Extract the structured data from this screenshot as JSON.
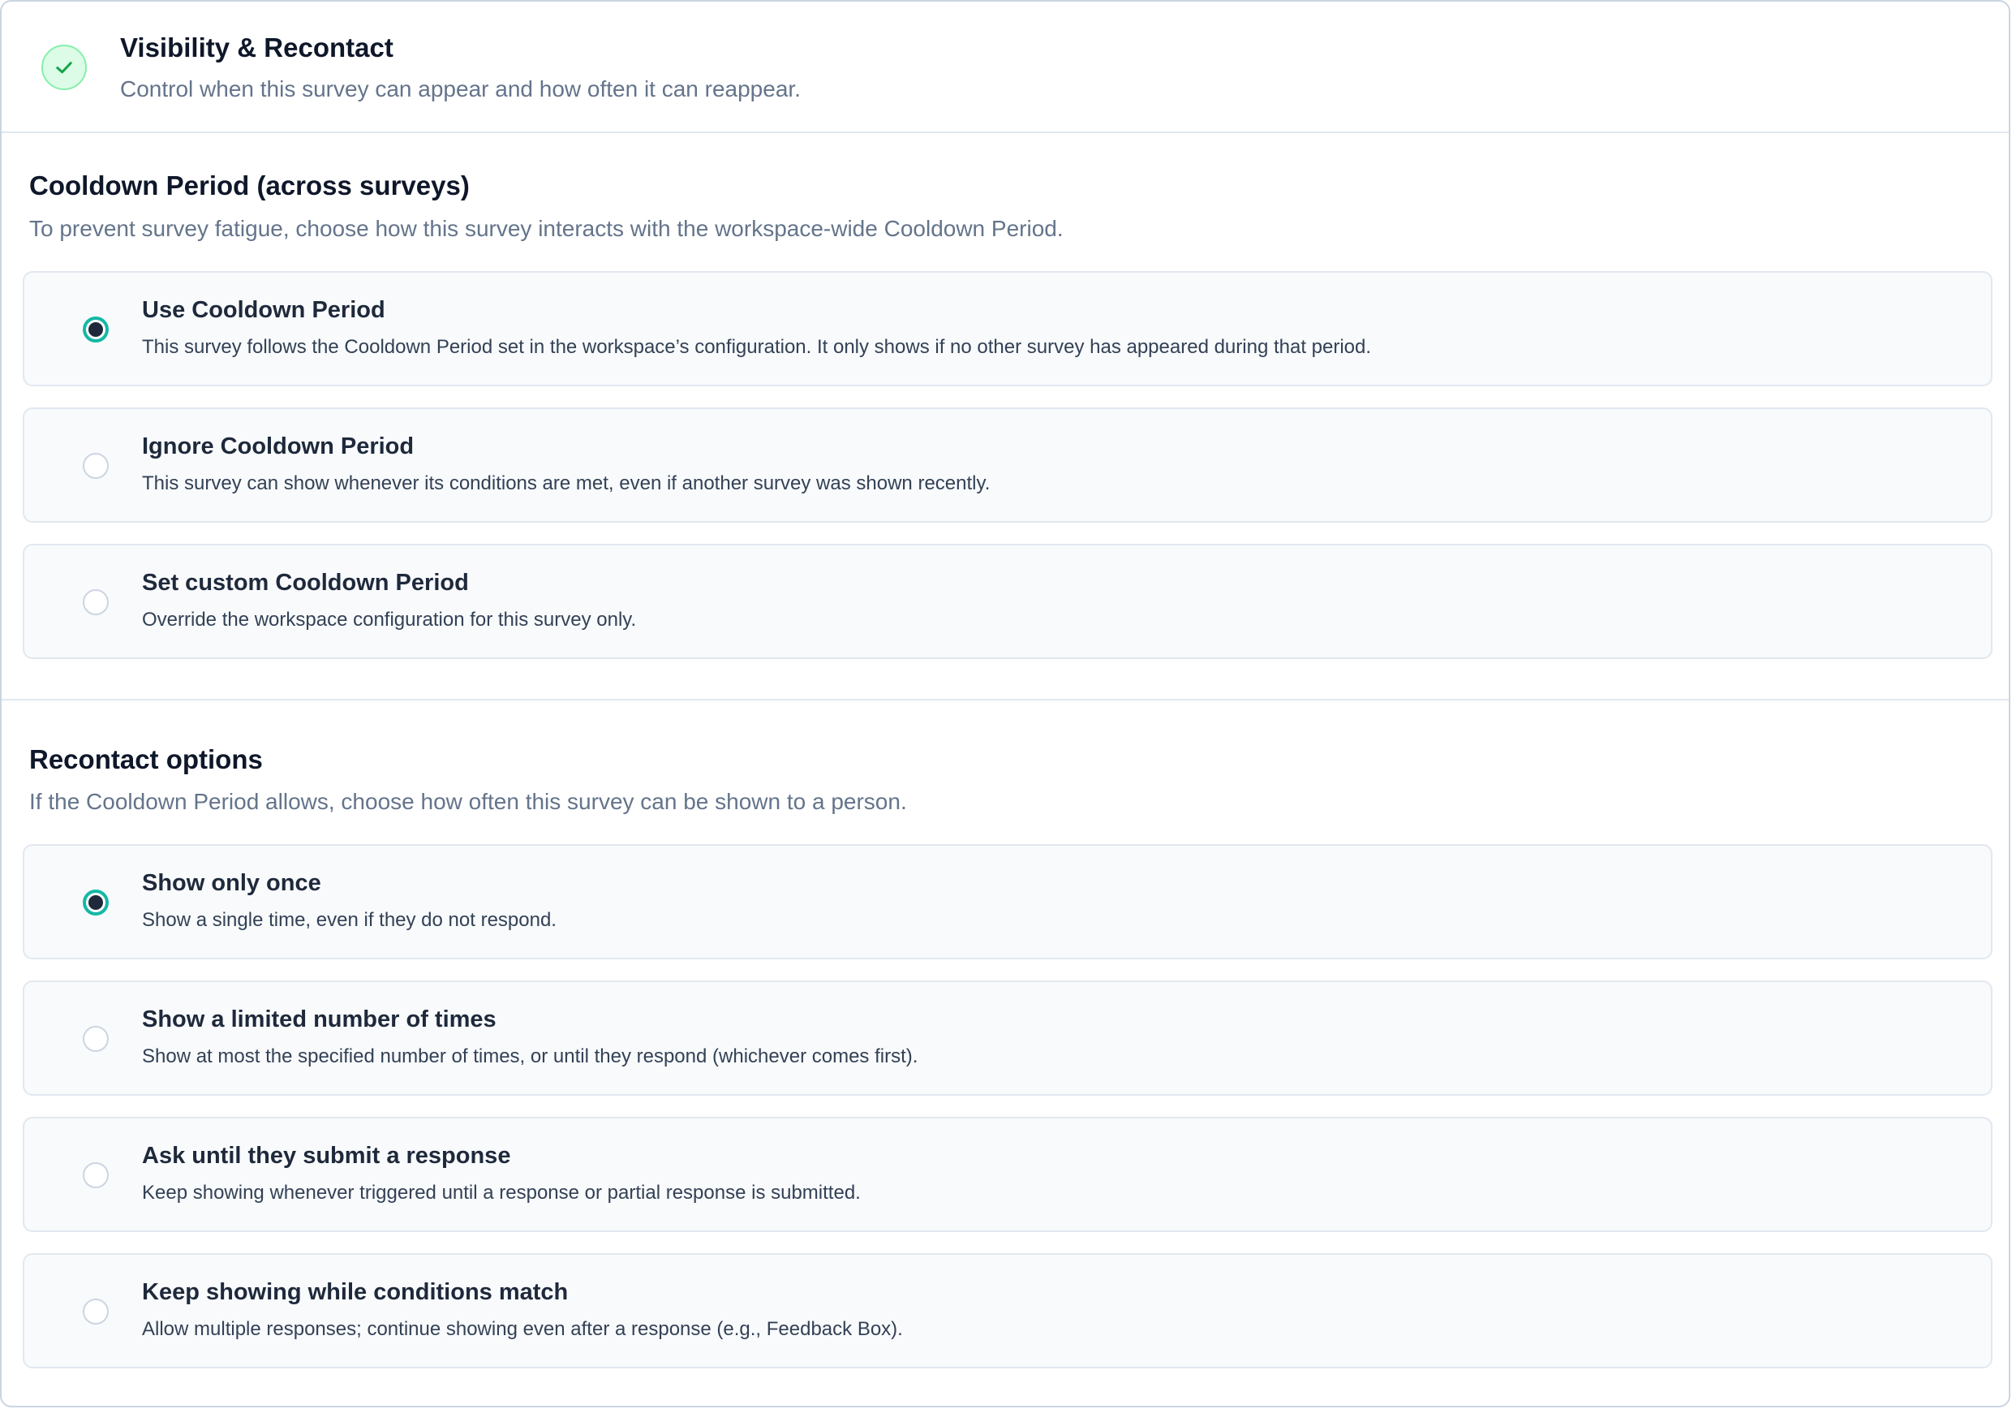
{
  "header": {
    "title": "Visibility & Recontact",
    "subtitle": "Control when this survey can appear and how often it can reappear.",
    "icon": "check-icon",
    "icon_color": "#16a34a"
  },
  "cooldown": {
    "title": "Cooldown Period (across surveys)",
    "subtitle": "To prevent survey fatigue, choose how this survey interacts with the workspace-wide Cooldown Period.",
    "options": [
      {
        "label": "Use Cooldown Period",
        "description": "This survey follows the Cooldown Period set in the workspace’s configuration. It only shows if no other survey has appeared during that period.",
        "selected": true
      },
      {
        "label": "Ignore Cooldown Period",
        "description": "This survey can show whenever its conditions are met, even if another survey was shown recently.",
        "selected": false
      },
      {
        "label": "Set custom Cooldown Period",
        "description": "Override the workspace configuration for this survey only.",
        "selected": false
      }
    ]
  },
  "recontact": {
    "title": "Recontact options",
    "subtitle": "If the Cooldown Period allows, choose how often this survey can be shown to a person.",
    "options": [
      {
        "label": "Show only once",
        "description": "Show a single time, even if they do not respond.",
        "selected": true
      },
      {
        "label": "Show a limited number of times",
        "description": "Show at most the specified number of times, or until they respond (whichever comes first).",
        "selected": false
      },
      {
        "label": "Ask until they submit a response",
        "description": "Keep showing whenever triggered until a response or partial response is submitted.",
        "selected": false
      },
      {
        "label": "Keep showing while conditions match",
        "description": "Allow multiple responses; continue showing even after a response (e.g., Feedback Box).",
        "selected": false
      }
    ]
  },
  "colors": {
    "accent": "#14b8a6",
    "radio_dot": "#1e293b",
    "border": "#e2e8f0",
    "option_bg": "#f8fafc"
  }
}
